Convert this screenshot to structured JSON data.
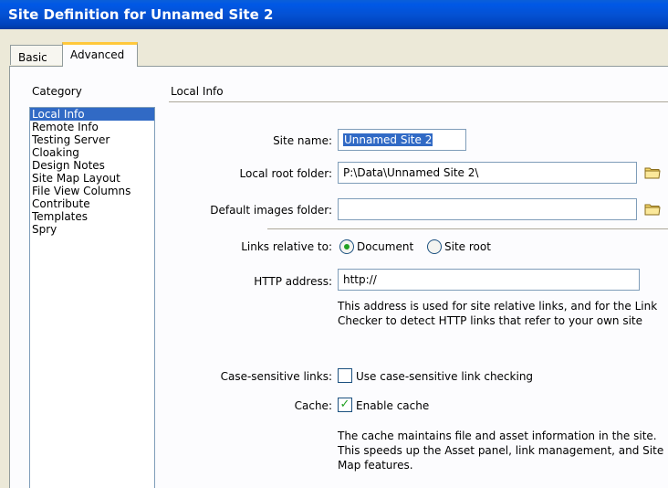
{
  "window": {
    "title": "Site Definition for Unnamed Site 2"
  },
  "tabs": {
    "basic": "Basic",
    "advanced": "Advanced"
  },
  "category": {
    "label": "Category",
    "items": [
      "Local Info",
      "Remote Info",
      "Testing Server",
      "Cloaking",
      "Design Notes",
      "Site Map Layout",
      "File View Columns",
      "Contribute",
      "Templates",
      "Spry"
    ],
    "selected": "Local Info"
  },
  "local_info": {
    "section_title": "Local Info",
    "site_name_label": "Site name:",
    "site_name_value": "Unnamed Site 2",
    "local_root_label": "Local root folder:",
    "local_root_value": "P:\\Data\\Unnamed Site 2\\",
    "default_images_label": "Default images folder:",
    "default_images_value": "",
    "links_relative_label": "Links relative to:",
    "links_option_document": "Document",
    "links_option_site_root": "Site root",
    "links_selected": "Document",
    "http_label": "HTTP address:",
    "http_value": "http://",
    "http_note": "This address is used for site relative links, and for the Link Checker to detect HTTP links that refer to your own site",
    "case_label": "Case-sensitive links:",
    "case_checkbox_label": "Use case-sensitive link checking",
    "case_checked": false,
    "cache_label": "Cache:",
    "cache_checkbox_label": "Enable cache",
    "cache_checked": true,
    "cache_note": "The cache maintains file and asset information in the site.  This speeds up the Asset panel, link management, and Site Map features."
  },
  "icons": {
    "folder": "folder-icon"
  },
  "colors": {
    "title_bar": "#0451d3",
    "selection": "#316ac5",
    "tab_highlight": "#ffc83c"
  }
}
